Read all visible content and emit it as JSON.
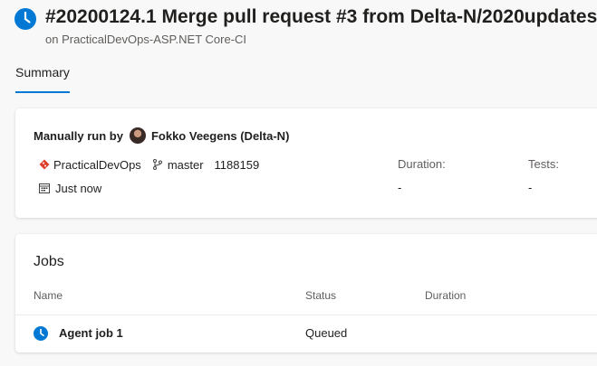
{
  "header": {
    "title": "#20200124.1 Merge pull request #3 from Delta-N/2020updates",
    "subtitle": "on PracticalDevOps-ASP.NET Core-CI",
    "status_icon": "clock-icon",
    "accent_color": "#0078d4"
  },
  "tabs": [
    {
      "label": "Summary",
      "selected": true
    }
  ],
  "summary": {
    "trigger_prefix": "Manually run by",
    "user": "Fokko Veegens (Delta-N)",
    "repo": "PracticalDevOps",
    "branch": "master",
    "commit": "1188159",
    "time": "Just now",
    "duration_label": "Duration:",
    "duration_value": "-",
    "tests_label": "Tests:",
    "tests_value": "-"
  },
  "jobs": {
    "title": "Jobs",
    "columns": {
      "name": "Name",
      "status": "Status",
      "duration": "Duration"
    },
    "rows": [
      {
        "name": "Agent job 1",
        "status": "Queued",
        "duration": ""
      }
    ]
  }
}
